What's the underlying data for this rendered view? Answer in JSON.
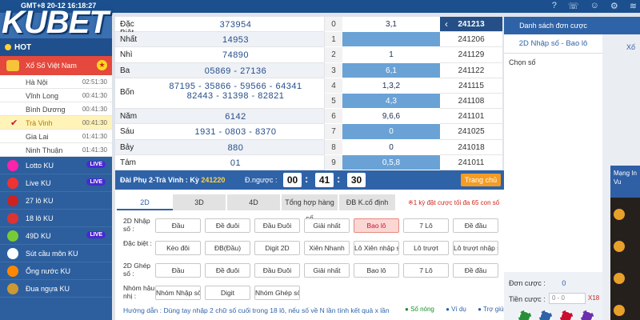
{
  "topbar": {
    "clock": "GMT+8 20-12 16:18:27"
  },
  "logo": {
    "text": "KUBET"
  },
  "sidebar": {
    "hot": "HOT",
    "xoso": "Xổ Số Việt Nam",
    "provinces": [
      {
        "name": "Hà Nội",
        "time": "02:51:30",
        "active": false
      },
      {
        "name": "Vĩnh Long",
        "time": "00:41:30",
        "active": false
      },
      {
        "name": "Bình Dương",
        "time": "00:41:30",
        "active": false
      },
      {
        "name": "Trà Vinh",
        "time": "00:41:30",
        "active": true
      },
      {
        "name": "Gia Lai",
        "time": "01:41:30",
        "active": false
      },
      {
        "name": "Ninh Thuận",
        "time": "01:41:30",
        "active": false
      }
    ],
    "games": [
      {
        "name": "Lotto KU",
        "live": "LIVE"
      },
      {
        "name": "Live KU",
        "live": "LIVE"
      },
      {
        "name": "27 lô KU",
        "live": ""
      },
      {
        "name": "18 lô KU",
        "live": ""
      },
      {
        "name": "49D KU",
        "live": "LIVE"
      },
      {
        "name": "Sút cầu môn KU",
        "live": ""
      },
      {
        "name": "Ống nước KU",
        "live": ""
      },
      {
        "name": "Đua ngựa KU",
        "live": ""
      }
    ]
  },
  "results": {
    "rows": [
      {
        "name": "Đặc Biệt",
        "value": "373954"
      },
      {
        "name": "Nhất",
        "value": "14953"
      },
      {
        "name": "Nhì",
        "value": "74890"
      },
      {
        "name": "Ba",
        "value": "05869 - 27136"
      },
      {
        "name": "Bốn",
        "value": "87195 - 35866 - 59566 - 64341",
        "value2": "82443 - 31398 - 82821"
      },
      {
        "name": "Năm",
        "value": "6142"
      },
      {
        "name": "Sáu",
        "value": "1931 - 0803 - 8370"
      },
      {
        "name": "Bảy",
        "value": "880"
      },
      {
        "name": "Tám",
        "value": "01"
      }
    ]
  },
  "loto": {
    "rows": [
      {
        "idx": "0",
        "val": "3,1",
        "key": "241213"
      },
      {
        "idx": "1",
        "val": "",
        "key": "241206"
      },
      {
        "idx": "2",
        "val": "1",
        "key": "241129"
      },
      {
        "idx": "3",
        "val": "6,1",
        "key": "241122"
      },
      {
        "idx": "4",
        "val": "1,3,2",
        "key": "241115"
      },
      {
        "idx": "5",
        "val": "4,3",
        "key": "241108"
      },
      {
        "idx": "6",
        "val": "9,6,6",
        "key": "241101"
      },
      {
        "idx": "7",
        "val": "0",
        "key": "241025"
      },
      {
        "idx": "8",
        "val": "0",
        "key": "241018"
      },
      {
        "idx": "9",
        "val": "0,5,8",
        "key": "241011"
      }
    ]
  },
  "bet": {
    "title": "Đài Phụ 2-Trà Vinh : Kỳ",
    "period": "241220",
    "countdown_label": "Đ.ngược :",
    "hh": "00",
    "mm": "41",
    "ss": "30",
    "home": "Trang chủ",
    "tabs": [
      "2D",
      "3D",
      "4D",
      "Tổng hợp hàng số",
      "ĐB K.cố định"
    ],
    "notice": "※1 kỳ đặt cược tối đa 65 con số",
    "rows": [
      {
        "label": "2D Nhập số :",
        "buttons": [
          "Đầu",
          "Đề đuôi",
          "Đầu Đuôi",
          "Giải nhất",
          "Bao lô",
          "7 Lô",
          "Đề đầu"
        ]
      },
      {
        "label": "Đặc biệt :",
        "buttons": [
          "Kèo đôi",
          "ĐB(Đầu)",
          "Digit 2D",
          "Xiên Nhanh",
          "Lô Xiên nhập số",
          "Lô trượt",
          "Lô trượt nhập số"
        ]
      },
      {
        "label": "2D Ghép số :",
        "buttons": [
          "Đầu",
          "Đề đuôi",
          "Đầu Đuôi",
          "Giải nhất",
          "Bao lô",
          "7 Lô",
          "Đề đầu"
        ]
      },
      {
        "label": "Nhóm hậu nhị :",
        "buttons": [
          "Nhóm Nhập số",
          "Digit",
          "Nhóm Ghép số"
        ]
      }
    ],
    "guide": "Hướng dẫn : Dùng tay nhập 2 chữ số cuối trong 18 lô, nếu số về N lần tính kết quả x lần",
    "links": [
      "Số nóng",
      "Ví dụ",
      "Trợ giúp"
    ]
  },
  "orders": {
    "head": "Danh sách đơn cược",
    "type": "2D Nhập số - Bao lô",
    "choose": "Chọn số",
    "count_label": "Đơn cược :",
    "count": "0",
    "money_label": "Tiền cược :",
    "placeholder": "0 - 0",
    "multiplier": "X18"
  },
  "right": {
    "close": "Xố",
    "promo": "Mạng In Vu"
  },
  "colors": {
    "primary": "#2f63a8",
    "accent": "#e5483c",
    "live": "#4a2ad0",
    "orange": "#f59c23"
  }
}
